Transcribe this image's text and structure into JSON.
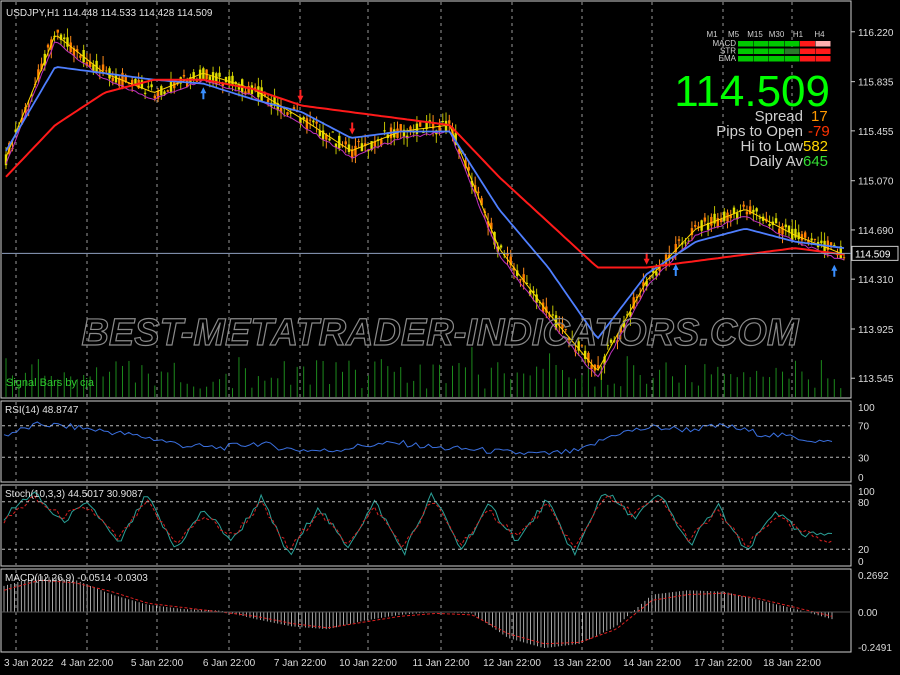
{
  "header": {
    "symbol_line": "USDJPY,H1  114.448 114.533 114.428 114.509"
  },
  "watermark": "BEST-METATRADER-INDICATORS.COM",
  "signal_label": "Signal Bars by cja",
  "info_panel": {
    "timeframes": [
      "M1",
      "M5",
      "M15",
      "M30",
      "H1",
      "H4"
    ],
    "rows": [
      "MACD",
      "STR",
      "EMA"
    ],
    "price": "114.509",
    "spread_label": "Spread",
    "spread_value": "17",
    "pips_label": "Pips to Open",
    "pips_value": "-79",
    "hilo_label": "Hi to Low",
    "hilo_value": "582",
    "daily_label": "Daily Av",
    "daily_value": "645",
    "colors": {
      "price": "#00ff00",
      "orange": "#ff9900",
      "red": "#ff3300",
      "yellow": "#ffd700",
      "green": "#33dd33"
    }
  },
  "chart_data": [
    {
      "type": "line",
      "title": "USDJPY,H1",
      "panel": "price",
      "ylim": [
        113.4,
        116.45
      ],
      "yticks": [
        "116.220",
        "115.835",
        "115.455",
        "115.070",
        "114.690",
        "114.310",
        "113.925",
        "113.545"
      ],
      "current_price": "114.509",
      "x": [
        "3 Jan 2022",
        "4 Jan 22:00",
        "5 Jan 22:00",
        "6 Jan 22:00",
        "7 Jan 22:00",
        "10 Jan 22:00",
        "11 Jan 22:00",
        "12 Jan 22:00",
        "13 Jan 22:00",
        "14 Jan 22:00",
        "17 Jan 22:00",
        "18 Jan 22:00"
      ],
      "series": [
        {
          "color": "#ffd700",
          "values": [
            115.25,
            116.2,
            115.9,
            115.75,
            115.9,
            115.78,
            115.55,
            115.3,
            115.45,
            115.5,
            114.55,
            114.05,
            113.6,
            114.3,
            114.7,
            114.85,
            114.65,
            114.5
          ]
        },
        {
          "color": "#4f7fff",
          "values": [
            115.3,
            115.95,
            115.9,
            115.85,
            115.82,
            115.7,
            115.6,
            115.4,
            115.45,
            115.45,
            114.85,
            114.4,
            113.85,
            114.35,
            114.6,
            114.7,
            114.6,
            114.55
          ]
        },
        {
          "color": "#ff1a1a",
          "values": [
            115.1,
            115.5,
            115.75,
            115.85,
            115.85,
            115.78,
            115.65,
            115.6,
            115.55,
            115.5,
            115.1,
            114.75,
            114.4,
            114.4,
            114.45,
            114.5,
            114.55,
            114.5
          ]
        }
      ],
      "arrows": {
        "down": [
          6,
          7,
          13
        ],
        "up": [
          4,
          13.6,
          16.8
        ]
      }
    },
    {
      "type": "line",
      "title": "RSI(14) 48.8747",
      "panel": "rsi",
      "ylim": [
        0,
        100
      ],
      "yticks": [
        "100",
        "70",
        "30",
        "0"
      ],
      "levels": [
        70,
        30
      ],
      "series": [
        {
          "color": "#3a70e0",
          "values": [
            58,
            72,
            68,
            62,
            55,
            45,
            42,
            48,
            40,
            38,
            45,
            48,
            42,
            40,
            36,
            34,
            38,
            60,
            68,
            65,
            70,
            60,
            55,
            48
          ]
        }
      ]
    },
    {
      "type": "line",
      "title": "Stoch(10,3,3) 44.5017 30.9087",
      "panel": "stoch",
      "ylim": [
        0,
        100
      ],
      "yticks": [
        "100",
        "80",
        "20",
        "0"
      ],
      "levels": [
        80,
        20
      ],
      "series": [
        {
          "color": "#2aa198",
          "values": [
            60,
            92,
            55,
            78,
            25,
            88,
            20,
            70,
            30,
            85,
            10,
            75,
            22,
            80,
            15,
            90,
            20,
            75,
            30,
            82,
            12,
            95,
            60,
            88,
            25,
            75,
            15,
            70,
            35,
            44
          ]
        },
        {
          "color": "#d62020",
          "values": [
            55,
            85,
            62,
            72,
            32,
            80,
            28,
            62,
            36,
            78,
            18,
            68,
            28,
            72,
            22,
            82,
            26,
            68,
            36,
            76,
            20,
            88,
            66,
            82,
            32,
            68,
            22,
            62,
            40,
            31
          ]
        }
      ]
    },
    {
      "type": "bar",
      "title": "MACD(12,26,9) -0.0514 -0.0303",
      "panel": "macd",
      "ylim": [
        -0.27,
        0.29
      ],
      "yticks": [
        "0.2692",
        "0.00",
        "-0.2491"
      ],
      "values": [
        0.18,
        0.25,
        0.22,
        0.12,
        0.05,
        0.02,
        0.01,
        -0.05,
        -0.1,
        -0.12,
        -0.06,
        -0.02,
        0.0,
        -0.01,
        -0.18,
        -0.25,
        -0.22,
        -0.1,
        0.12,
        0.15,
        0.14,
        0.08,
        0.02,
        -0.05
      ],
      "signal": [
        0.15,
        0.22,
        0.2,
        0.14,
        0.06,
        0.03,
        0.0,
        -0.03,
        -0.08,
        -0.11,
        -0.07,
        -0.03,
        -0.01,
        -0.02,
        -0.15,
        -0.22,
        -0.21,
        -0.12,
        0.08,
        0.12,
        0.13,
        0.09,
        0.03,
        -0.03
      ]
    }
  ]
}
